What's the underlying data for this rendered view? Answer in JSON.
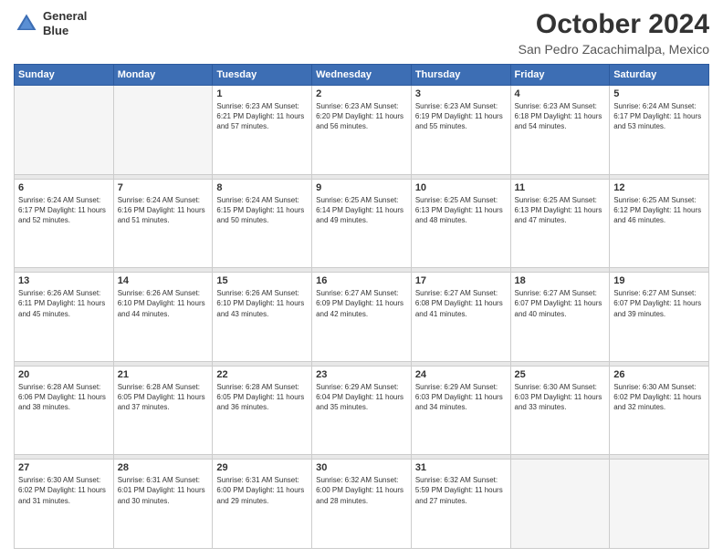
{
  "header": {
    "logo_line1": "General",
    "logo_line2": "Blue",
    "title": "October 2024",
    "subtitle": "San Pedro Zacachimalpa, Mexico"
  },
  "weekdays": [
    "Sunday",
    "Monday",
    "Tuesday",
    "Wednesday",
    "Thursday",
    "Friday",
    "Saturday"
  ],
  "weeks": [
    [
      {
        "day": "",
        "info": ""
      },
      {
        "day": "",
        "info": ""
      },
      {
        "day": "1",
        "info": "Sunrise: 6:23 AM\nSunset: 6:21 PM\nDaylight: 11 hours\nand 57 minutes."
      },
      {
        "day": "2",
        "info": "Sunrise: 6:23 AM\nSunset: 6:20 PM\nDaylight: 11 hours\nand 56 minutes."
      },
      {
        "day": "3",
        "info": "Sunrise: 6:23 AM\nSunset: 6:19 PM\nDaylight: 11 hours\nand 55 minutes."
      },
      {
        "day": "4",
        "info": "Sunrise: 6:23 AM\nSunset: 6:18 PM\nDaylight: 11 hours\nand 54 minutes."
      },
      {
        "day": "5",
        "info": "Sunrise: 6:24 AM\nSunset: 6:17 PM\nDaylight: 11 hours\nand 53 minutes."
      }
    ],
    [
      {
        "day": "6",
        "info": "Sunrise: 6:24 AM\nSunset: 6:17 PM\nDaylight: 11 hours\nand 52 minutes."
      },
      {
        "day": "7",
        "info": "Sunrise: 6:24 AM\nSunset: 6:16 PM\nDaylight: 11 hours\nand 51 minutes."
      },
      {
        "day": "8",
        "info": "Sunrise: 6:24 AM\nSunset: 6:15 PM\nDaylight: 11 hours\nand 50 minutes."
      },
      {
        "day": "9",
        "info": "Sunrise: 6:25 AM\nSunset: 6:14 PM\nDaylight: 11 hours\nand 49 minutes."
      },
      {
        "day": "10",
        "info": "Sunrise: 6:25 AM\nSunset: 6:13 PM\nDaylight: 11 hours\nand 48 minutes."
      },
      {
        "day": "11",
        "info": "Sunrise: 6:25 AM\nSunset: 6:13 PM\nDaylight: 11 hours\nand 47 minutes."
      },
      {
        "day": "12",
        "info": "Sunrise: 6:25 AM\nSunset: 6:12 PM\nDaylight: 11 hours\nand 46 minutes."
      }
    ],
    [
      {
        "day": "13",
        "info": "Sunrise: 6:26 AM\nSunset: 6:11 PM\nDaylight: 11 hours\nand 45 minutes."
      },
      {
        "day": "14",
        "info": "Sunrise: 6:26 AM\nSunset: 6:10 PM\nDaylight: 11 hours\nand 44 minutes."
      },
      {
        "day": "15",
        "info": "Sunrise: 6:26 AM\nSunset: 6:10 PM\nDaylight: 11 hours\nand 43 minutes."
      },
      {
        "day": "16",
        "info": "Sunrise: 6:27 AM\nSunset: 6:09 PM\nDaylight: 11 hours\nand 42 minutes."
      },
      {
        "day": "17",
        "info": "Sunrise: 6:27 AM\nSunset: 6:08 PM\nDaylight: 11 hours\nand 41 minutes."
      },
      {
        "day": "18",
        "info": "Sunrise: 6:27 AM\nSunset: 6:07 PM\nDaylight: 11 hours\nand 40 minutes."
      },
      {
        "day": "19",
        "info": "Sunrise: 6:27 AM\nSunset: 6:07 PM\nDaylight: 11 hours\nand 39 minutes."
      }
    ],
    [
      {
        "day": "20",
        "info": "Sunrise: 6:28 AM\nSunset: 6:06 PM\nDaylight: 11 hours\nand 38 minutes."
      },
      {
        "day": "21",
        "info": "Sunrise: 6:28 AM\nSunset: 6:05 PM\nDaylight: 11 hours\nand 37 minutes."
      },
      {
        "day": "22",
        "info": "Sunrise: 6:28 AM\nSunset: 6:05 PM\nDaylight: 11 hours\nand 36 minutes."
      },
      {
        "day": "23",
        "info": "Sunrise: 6:29 AM\nSunset: 6:04 PM\nDaylight: 11 hours\nand 35 minutes."
      },
      {
        "day": "24",
        "info": "Sunrise: 6:29 AM\nSunset: 6:03 PM\nDaylight: 11 hours\nand 34 minutes."
      },
      {
        "day": "25",
        "info": "Sunrise: 6:30 AM\nSunset: 6:03 PM\nDaylight: 11 hours\nand 33 minutes."
      },
      {
        "day": "26",
        "info": "Sunrise: 6:30 AM\nSunset: 6:02 PM\nDaylight: 11 hours\nand 32 minutes."
      }
    ],
    [
      {
        "day": "27",
        "info": "Sunrise: 6:30 AM\nSunset: 6:02 PM\nDaylight: 11 hours\nand 31 minutes."
      },
      {
        "day": "28",
        "info": "Sunrise: 6:31 AM\nSunset: 6:01 PM\nDaylight: 11 hours\nand 30 minutes."
      },
      {
        "day": "29",
        "info": "Sunrise: 6:31 AM\nSunset: 6:00 PM\nDaylight: 11 hours\nand 29 minutes."
      },
      {
        "day": "30",
        "info": "Sunrise: 6:32 AM\nSunset: 6:00 PM\nDaylight: 11 hours\nand 28 minutes."
      },
      {
        "day": "31",
        "info": "Sunrise: 6:32 AM\nSunset: 5:59 PM\nDaylight: 11 hours\nand 27 minutes."
      },
      {
        "day": "",
        "info": ""
      },
      {
        "day": "",
        "info": ""
      }
    ]
  ]
}
